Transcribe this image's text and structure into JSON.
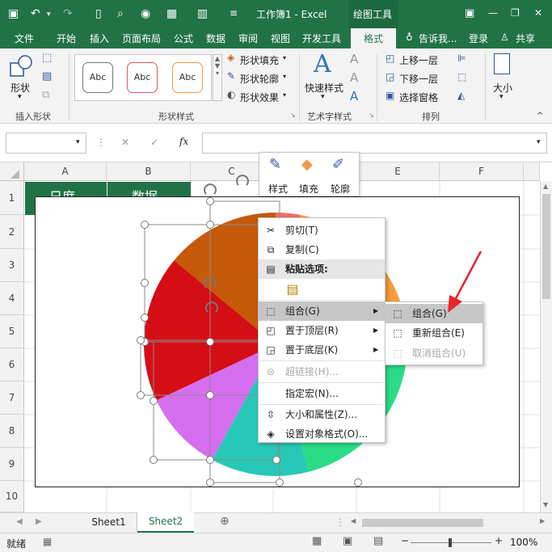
{
  "window": {
    "title": "工作簿1 - Excel",
    "context_tab": "绘图工具",
    "buttons": {
      "minimize": "—",
      "restore": "❐",
      "close": "✕"
    }
  },
  "qat": {
    "save_icon": "save-icon",
    "undo_icon": "undo-icon",
    "redo_icon": "redo-icon"
  },
  "tabs": [
    "文件",
    "开始",
    "插入",
    "页面布局",
    "公式",
    "数据",
    "审阅",
    "视图",
    "开发工具",
    "格式"
  ],
  "active_tab": "格式",
  "tellme": "告诉我...",
  "signin": "登录",
  "share": "共享",
  "ribbon": {
    "shape_label": "形状",
    "group_insert_shapes": "插入形状",
    "style_samples": [
      "Abc",
      "Abc",
      "Abc"
    ],
    "shape_fill": "形状填充",
    "shape_outline": "形状轮廓",
    "shape_effects": "形状效果",
    "group_shape_styles": "形状样式",
    "quick_styles": "快速样式",
    "group_wordart": "艺术字样式",
    "bring_forward": "上移一层",
    "send_backward": "下移一层",
    "selection_pane": "选择窗格",
    "group_arrange": "排列",
    "size": "大小"
  },
  "formula_bar": {
    "name_box": "",
    "fx": "fx",
    "cancel": "✕",
    "enter": "✓"
  },
  "columns": [
    "A",
    "B",
    "C",
    "D",
    "E",
    "F"
  ],
  "rows": [
    "1",
    "2",
    "3",
    "4",
    "5",
    "6",
    "7",
    "8",
    "9",
    "10"
  ],
  "cells": {
    "a1": "日度",
    "b1": "数据"
  },
  "pie": {
    "slices": [
      {
        "color": "#f26b6b",
        "percent": 3
      },
      {
        "color": "#f79d3b",
        "percent": 22
      },
      {
        "color": "#2adc86",
        "percent": 21
      },
      {
        "color": "#28c8b8",
        "percent": 12
      },
      {
        "color": "#d66ef0",
        "percent": 10
      },
      {
        "color": "#d50d14",
        "percent": 18
      },
      {
        "color": "#c55a0a",
        "percent": 14
      }
    ]
  },
  "mini_toolbar": {
    "style": "样式",
    "fill": "填充",
    "outline": "轮廓"
  },
  "context_menu": {
    "cut": "剪切(T)",
    "copy": "复制(C)",
    "paste_options": "粘贴选项:",
    "group": "组合(G)",
    "bring_to_front": "置于顶层(R)",
    "send_to_back": "置于底层(K)",
    "hyperlink": "超链接(H)...",
    "assign_macro": "指定宏(N)...",
    "size_properties": "大小和属性(Z)...",
    "format_object": "设置对象格式(O)..."
  },
  "submenu": {
    "group": "组合(G)",
    "regroup": "重新组合(E)",
    "ungroup": "取消组合(U)"
  },
  "sheets": [
    "Sheet1",
    "Sheet2"
  ],
  "active_sheet": "Sheet2",
  "status": {
    "ready": "就绪",
    "zoom": "100%"
  },
  "colors": {
    "excel_green": "#217346",
    "arrow": "#e8262a"
  }
}
